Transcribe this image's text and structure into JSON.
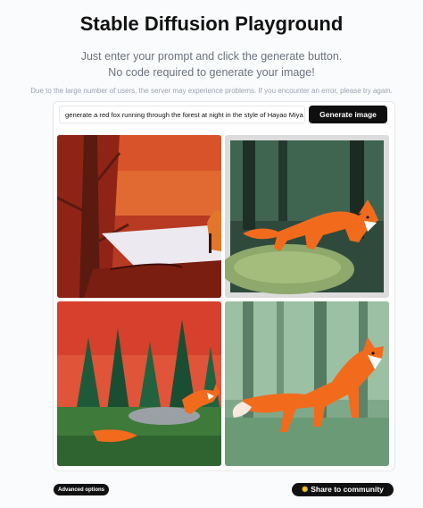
{
  "header": {
    "title": "Stable Diffusion Playground",
    "subtitle_line1": "Just enter your prompt and click the generate button.",
    "subtitle_line2": "No code required to generate your image!",
    "notice": "Due to the large number of users, the server may experience problems. If you encounter an error, please try again."
  },
  "prompt": {
    "value": "generate a red fox running through the forest at night in the style of Hayao Miya"
  },
  "buttons": {
    "generate_label": "Generate image",
    "advanced_label": "Advanced options",
    "share_label": "Share to community",
    "share_icon": "sparkle-icon"
  },
  "gallery": {
    "images": [
      {
        "subject": "fox-by-red-forest-lake"
      },
      {
        "subject": "fox-in-green-forest-on-rock"
      },
      {
        "subject": "fox-in-red-sky-pine-forest"
      },
      {
        "subject": "fox-walking-in-misty-forest"
      }
    ]
  },
  "colors": {
    "primary_button": "#0f0f0f",
    "fox_orange": "#f26b1d"
  }
}
